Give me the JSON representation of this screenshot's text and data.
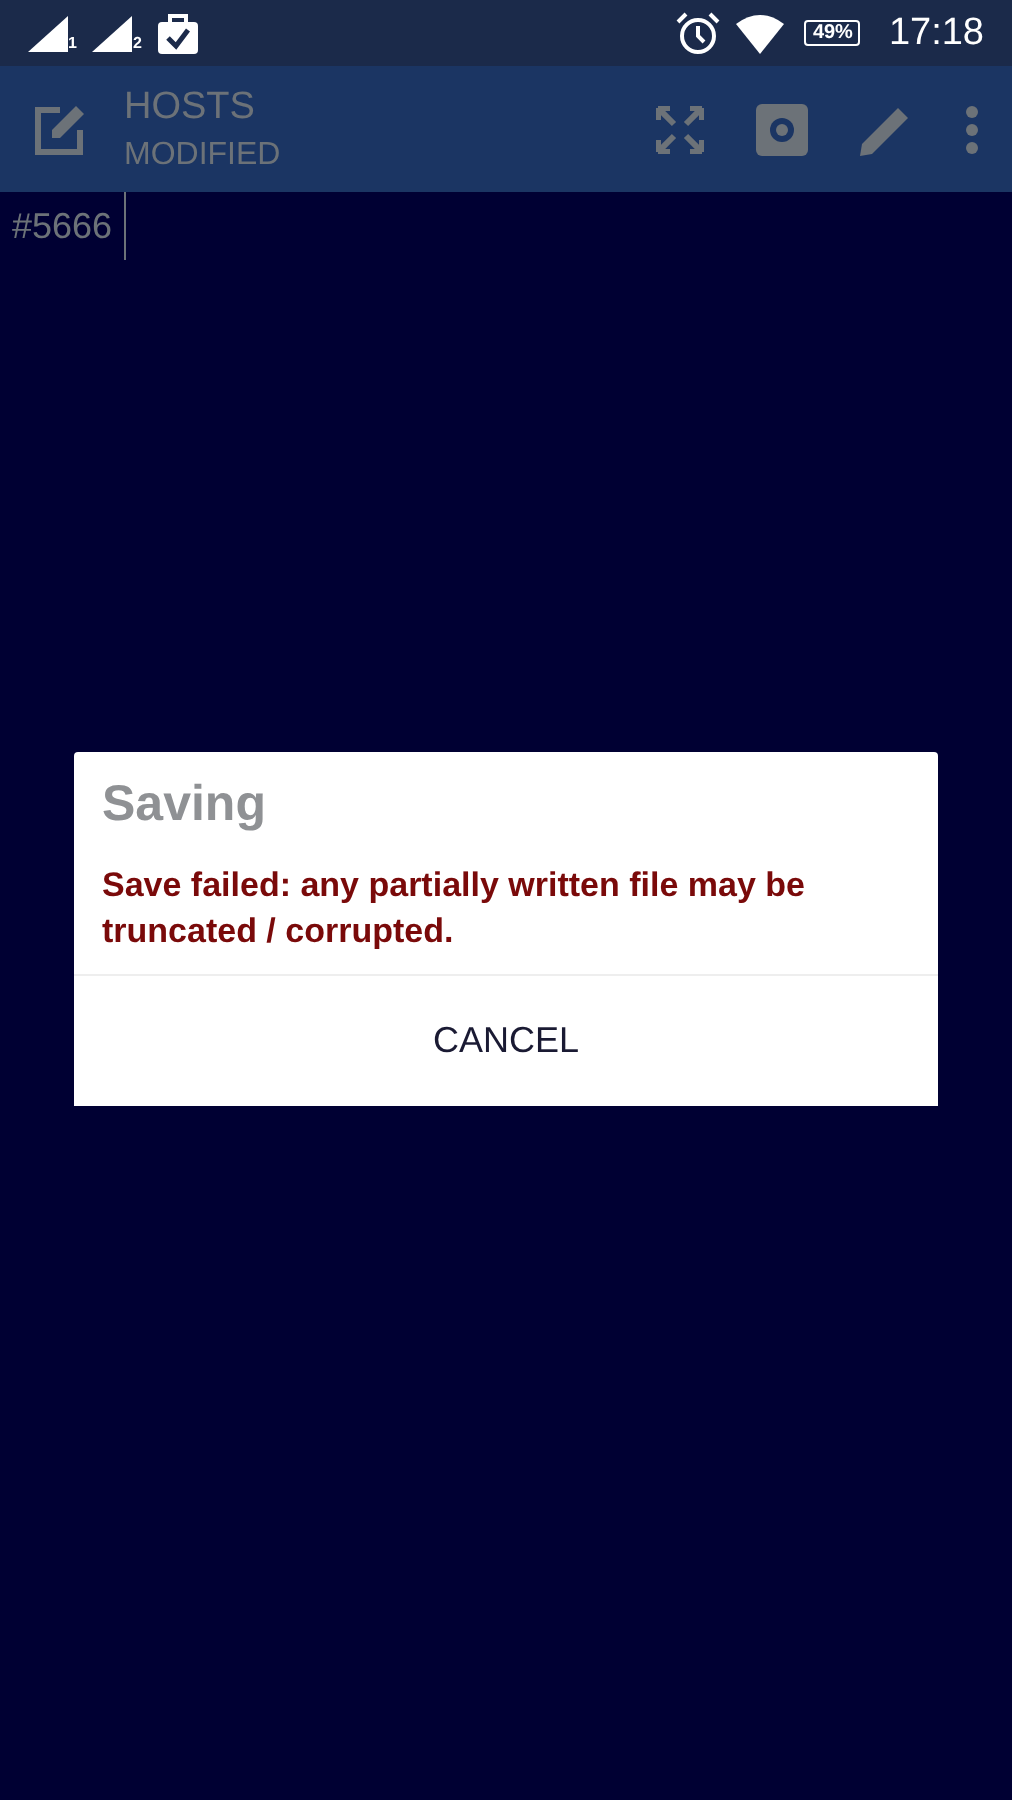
{
  "status_bar": {
    "sim_labels": [
      "1",
      "2"
    ],
    "battery": "49%",
    "time": "17:18"
  },
  "toolbar": {
    "title": "HOSTS",
    "subtitle": "MODIFIED"
  },
  "editor": {
    "text": "#5666"
  },
  "dialog": {
    "title": "Saving",
    "message": "Save failed: any partially written file may be truncated / corrupted.",
    "buttons": [
      "CANCEL"
    ]
  }
}
